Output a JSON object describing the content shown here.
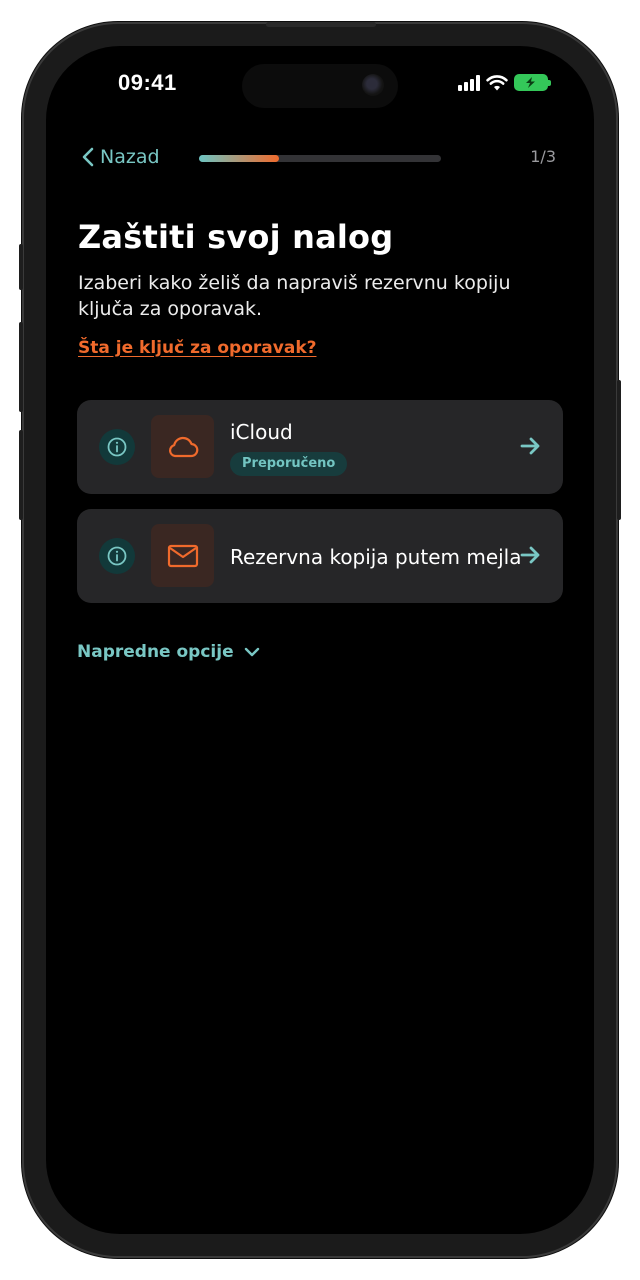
{
  "status_bar": {
    "time": "09:41"
  },
  "nav": {
    "back_label": "Nazad",
    "progress": 0.33,
    "step_indicator": "1/3"
  },
  "header": {
    "title": "Zaštiti svoj nalog",
    "subtitle": "Izaberi kako želiš da napraviš rezervnu kopiju ključa za oporavak.",
    "help_link": "Šta je ključ za oporavak?"
  },
  "options": [
    {
      "label": "iCloud",
      "badge": "Preporučeno",
      "icon": "cloud-icon"
    },
    {
      "label": "Rezervna kopija putem mejla",
      "icon": "mail-icon"
    }
  ],
  "advanced": {
    "label": "Napredne opcije"
  },
  "colors": {
    "accent_teal": "#79c7c4",
    "accent_orange": "#f06a2c",
    "background": "#000000",
    "card": "#262628",
    "battery_green": "#34c759"
  }
}
